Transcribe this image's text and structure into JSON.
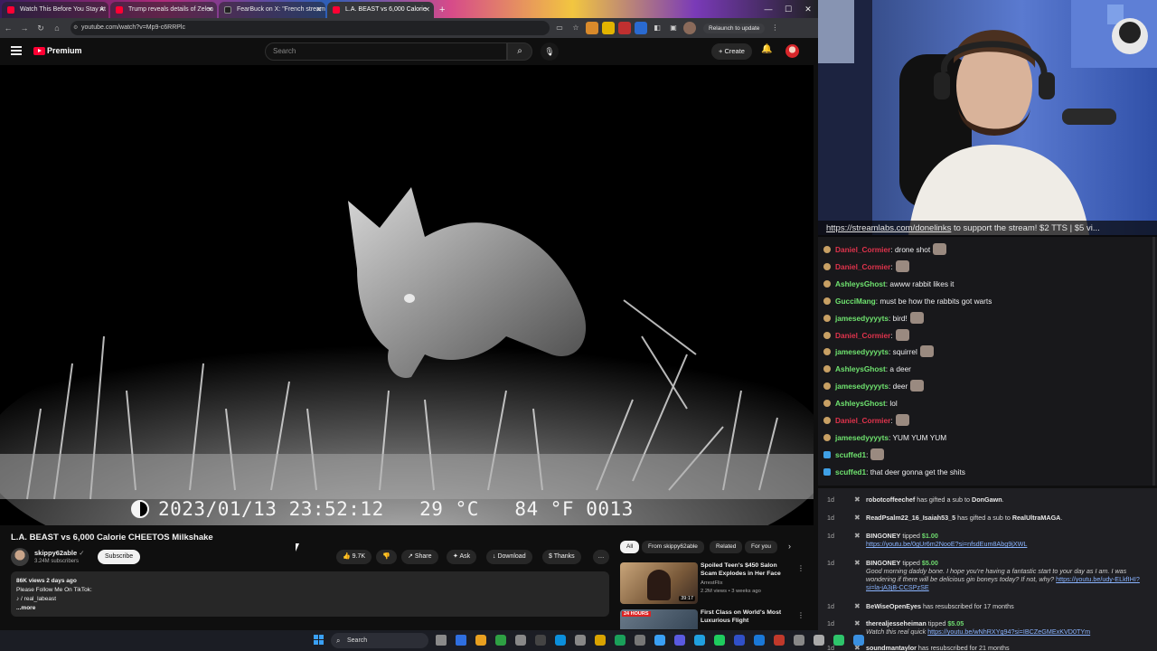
{
  "browser": {
    "tabs": [
      {
        "title": "Watch This Before You Stay At",
        "color": "#ff0033"
      },
      {
        "title": "Trump reveals details of Zelen",
        "color": "#ff0033"
      },
      {
        "title": "FearBuck on X: \"French stream",
        "color": "#222222"
      },
      {
        "title": "L.A. BEAST vs 6,000 Calorie",
        "color": "#ff0033"
      }
    ],
    "new_tab": "+",
    "url": "youtube.com/watch?v=Mp9-c6RRPlc",
    "relaunch": "Relaunch to update"
  },
  "youtube": {
    "brand": "Premium",
    "search_placeholder": "Search",
    "create_label": "Create",
    "video": {
      "osd_datetime": "2023/01/13 23:52:12",
      "osd_temp_c": "29 °C",
      "osd_temp_f": "84 °F",
      "osd_frame": "0013"
    },
    "title": "L.A. BEAST vs 6,000 Calorie CHEETOS Milkshake",
    "channel": {
      "name": "skippy62able",
      "subs": "3.24M subscribers"
    },
    "subscribe": "Subscribe",
    "actions": {
      "likes": "9.7K",
      "share": "Share",
      "ask": "Ask",
      "download": "Download",
      "thanks": "Thanks"
    },
    "description": {
      "meta": "86K views  2 days ago",
      "line1": "Please Follow Me On TikTok:",
      "line2": "♪ / real_labeast",
      "more": "...more"
    },
    "chips": [
      "All",
      "From skippy62able",
      "Related",
      "For you"
    ],
    "recommendations": [
      {
        "title": "Spoiled Teen's $450 Salon Scam Explodes in Her Face",
        "channel": "ArrestFlix",
        "views": "2.2M views • 3 weeks ago",
        "duration": "39:17"
      },
      {
        "title": "First Class on World's Most Luxurious Flight",
        "channel": "",
        "views": "",
        "duration": "24 HOURS"
      }
    ]
  },
  "stream": {
    "banner_link": "https://streamlabs.com/donelinks",
    "banner_text": " to support the stream! $2 TTS | $5 vi...",
    "chat": [
      {
        "user": "Daniel_Cormier",
        "sep": ":",
        "text": " drone shot",
        "color": "#e0334c",
        "emote": true,
        "badge": "gold"
      },
      {
        "user": "Daniel_Cormier",
        "sep": ":",
        "text": "",
        "color": "#e0334c",
        "emote": true,
        "badge": "gold"
      },
      {
        "user": "AshleysGhost",
        "sep": ":",
        "text": " awww rabbit likes it",
        "color": "#6fe36f",
        "emote": false,
        "badge": "gold"
      },
      {
        "user": "GucciMang",
        "sep": ":",
        "text": " must be how the rabbits got warts",
        "color": "#6fe36f",
        "emote": false,
        "badge": "gold"
      },
      {
        "user": "jamesedyyyyts",
        "sep": ":",
        "text": " bird!",
        "color": "#6fe36f",
        "emote": true,
        "badge": "gold"
      },
      {
        "user": "Daniel_Cormier",
        "sep": ":",
        "text": "",
        "color": "#e0334c",
        "emote": true,
        "badge": "gold"
      },
      {
        "user": "jamesedyyyyts",
        "sep": ":",
        "text": " squirrel",
        "color": "#6fe36f",
        "emote": true,
        "badge": "gold"
      },
      {
        "user": "AshleysGhost",
        "sep": ":",
        "text": " a deer",
        "color": "#6fe36f",
        "emote": false,
        "badge": "gold"
      },
      {
        "user": "jamesedyyyyts",
        "sep": ":",
        "text": " deer",
        "color": "#6fe36f",
        "emote": true,
        "badge": "gold"
      },
      {
        "user": "AshleysGhost",
        "sep": ":",
        "text": " lol",
        "color": "#6fe36f",
        "emote": false,
        "badge": "gold"
      },
      {
        "user": "Daniel_Cormier",
        "sep": ":",
        "text": "",
        "color": "#e0334c",
        "emote": true,
        "badge": "gold"
      },
      {
        "user": "jamesedyyyyts",
        "sep": ":",
        "text": " YUM YUM YUM",
        "color": "#6fe36f",
        "emote": false,
        "badge": "gold"
      },
      {
        "user": "scuffed1",
        "sep": ":",
        "text": "",
        "color": "#6fe36f",
        "emote": true,
        "badge": "cube"
      },
      {
        "user": "scuffed1",
        "sep": ":",
        "text": " that deer gonna get the shits",
        "color": "#6fe36f",
        "emote": false,
        "badge": "cube"
      }
    ],
    "events": [
      {
        "age": "1d",
        "name": "robotcoffeechef",
        "text": " has gifted a sub to ",
        "name2": "DonGawn",
        "tail": ".",
        "quote": "",
        "link": ""
      },
      {
        "age": "1d",
        "name": "ReadPsalm22_16_Isaiah53_5",
        "text": " has gifted a sub to ",
        "name2": "RealUltraMAGA",
        "tail": ".",
        "quote": "",
        "link": ""
      },
      {
        "age": "1d",
        "name": "BINGONEY",
        "text": " tipped ",
        "amount": "$1.00",
        "quote": "",
        "link": "https://youtu.be/0gUr6m2NooE?si=nfsdEum8Abg9jXWL"
      },
      {
        "age": "1d",
        "name": "BINGONEY",
        "text": " tipped ",
        "amount": "$5.00",
        "quote": "Good morning daddy bone. I hope you're having a fantastic start to your day as I am. I was wondering if there will be delicious gin boneys today? If not, why? ",
        "link": "https://youtu.be/udy-ELkfIHI?si=la-jA3jB-CCSPzSE"
      },
      {
        "age": "1d",
        "name": "BeWiseOpenEyes",
        "text": " has resubscribed for 17 months",
        "quote": "",
        "link": ""
      },
      {
        "age": "1d",
        "name": "therealjesseheiman",
        "text": " tipped ",
        "amount": "$5.05",
        "quote": "Watch this real quick ",
        "link": "https://youtu.be/wNhRXYg94?si=IBCZeGMExKVD0TYm"
      },
      {
        "age": "1d",
        "name": "soundmantaylor",
        "text": " has resubscribed for 21 months",
        "quote": "",
        "link": ""
      }
    ]
  },
  "taskbar": {
    "search": "Search"
  },
  "colors": {
    "yt_red": "#ff0033",
    "chat_bg": "#18181b",
    "yt_bg": "#0f0f0f"
  }
}
